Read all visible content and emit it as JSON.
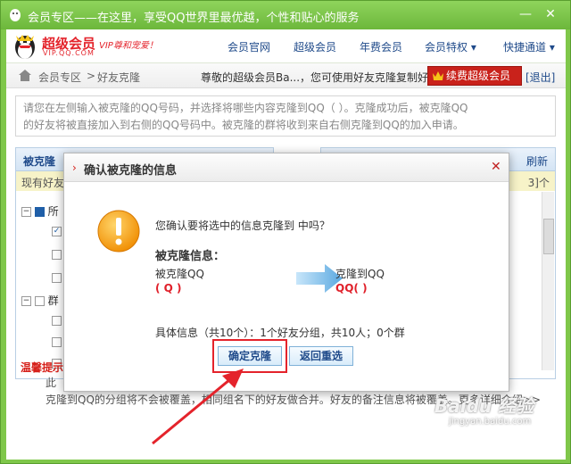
{
  "window": {
    "title": "会员专区——在这里，享受QQ世界里最优越，个性和贴心的服务",
    "buttons": {
      "minimize": "—",
      "close": "✕"
    }
  },
  "navbar": {
    "brand": "超级会员",
    "brand_url": "VIP.QQ.COM",
    "slogan": "VIP尊和宠爱！",
    "items": [
      {
        "label": "会员官网"
      },
      {
        "label": "超级会员"
      },
      {
        "label": "年费会员"
      },
      {
        "label": "会员特权 ▾"
      },
      {
        "label": "快捷通道 ▾"
      }
    ]
  },
  "breadcrumb": {
    "home": "会员专区",
    "sep": ">",
    "current": "好友克隆",
    "greeting": "尊敬的超级会员Ba...，您可使用好友克隆复制好友！",
    "renew_label": "续费超级会员",
    "exit_label": "[退出]"
  },
  "intro": {
    "line1": "请您在左侧输入被克隆的QQ号码，并选择将哪些内容克隆到QQ（                    ）。克隆成功后，被克隆QQ",
    "line2": "的好友将被直接加入到右侧的QQ号码中。被克隆的群将收到来自右侧克隆到QQ的加入申请。"
  },
  "left_panel": {
    "header": "被克隆",
    "sub": "现有好友",
    "rows": [
      {
        "label": "所"
      },
      {
        "label": ""
      },
      {
        "label": ""
      },
      {
        "label": ""
      },
      {
        "label": "群"
      },
      {
        "label": ""
      },
      {
        "label": ""
      },
      {
        "label": ""
      }
    ]
  },
  "right_panel": {
    "header_link": "刷新",
    "sub": "3]个"
  },
  "tips": {
    "title": "温馨提示",
    "line1": "此",
    "line2": "克隆到QQ的分组将不会被覆盖，相同组名下的好友做合并。好友的备注信息将被覆盖。更多详细介绍>>"
  },
  "modal": {
    "title": "确认被克隆的信息",
    "close": "✕",
    "confirm_msg": "您确认要将选中的信息克隆到               中吗？",
    "info_title": "被克隆信息：",
    "from_label": "被克隆QQ",
    "from_value": "( Q      )",
    "to_label": "克隆到QQ",
    "to_value": "QQ(        )",
    "detail": "具体信息（共10个）：1个好友分组，共10人；0个群",
    "confirm_button": "确定克隆",
    "back_button": "返回重选"
  },
  "watermark": {
    "main": "Baidu 经验",
    "sub": "jingyan.baidu.com"
  }
}
